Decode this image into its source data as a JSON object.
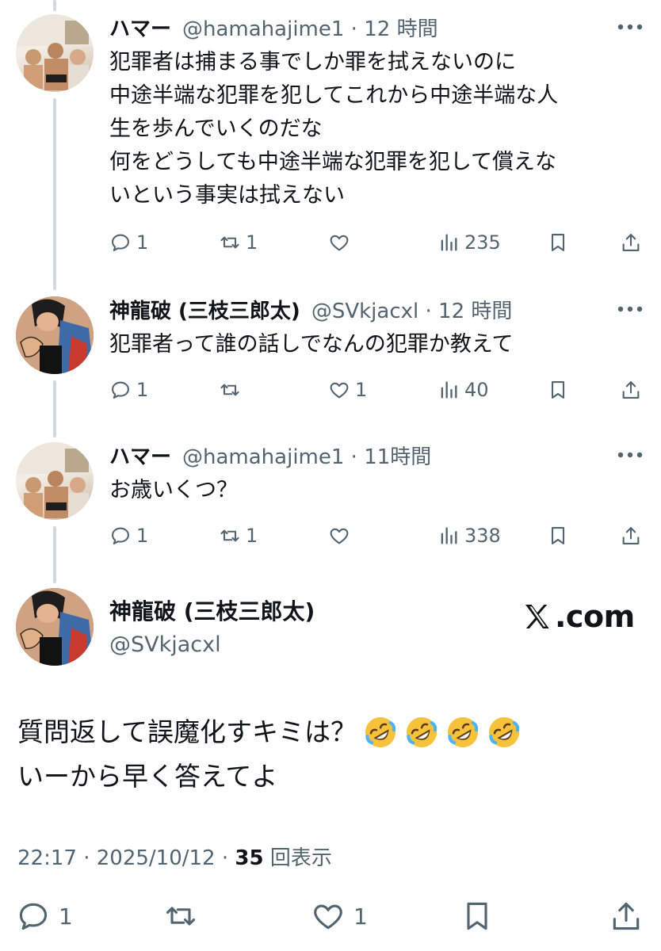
{
  "tweets": [
    {
      "name": "ハマー",
      "handle": "@hamahajime1",
      "time": "12 時間",
      "lines": [
        "犯罪者は捕まる事でしか罪を拭えないのに",
        "中途半端な犯罪を犯してこれから中途半端な人",
        "生を歩んでいくのだな",
        "何をどうしても中途半端な犯罪を犯して償えな",
        "いという事実は拭えない"
      ],
      "replies": "1",
      "retweets": "1",
      "likes": "",
      "views": "235"
    },
    {
      "name": "神龍破 (三枝三郎太)",
      "handle": "@SVkjacxl",
      "time": "12 時間",
      "lines": [
        "犯罪者って誰の話しでなんの犯罪か教えて"
      ],
      "replies": "1",
      "retweets": "",
      "likes": "1",
      "views": "40"
    },
    {
      "name": "ハマー",
      "handle": "@hamahajime1",
      "time": "11時間",
      "lines": [
        "お歳いくつ？"
      ],
      "replies": "1",
      "retweets": "1",
      "likes": "",
      "views": "338"
    }
  ],
  "main": {
    "name": "神龍破 (三枝三郎太)",
    "handle": "@SVkjacxl",
    "brand": ".com",
    "line1": "質問返して誤魔化すキミは？",
    "line1_emoji": [
      "rolling-on-floor-laughing",
      "rolling-on-floor-laughing",
      "rolling-on-floor-laughing",
      "rolling-on-floor-laughing"
    ],
    "line2": "いーから早く答えてよ",
    "time": "22:17",
    "date": "2025/10/12",
    "views": "35",
    "views_label": "回表示",
    "replies": "1",
    "retweets": "",
    "likes": "1"
  },
  "colors": {
    "text": "#0f1419",
    "secondary": "#536471",
    "thread_line": "#cfd9de"
  }
}
